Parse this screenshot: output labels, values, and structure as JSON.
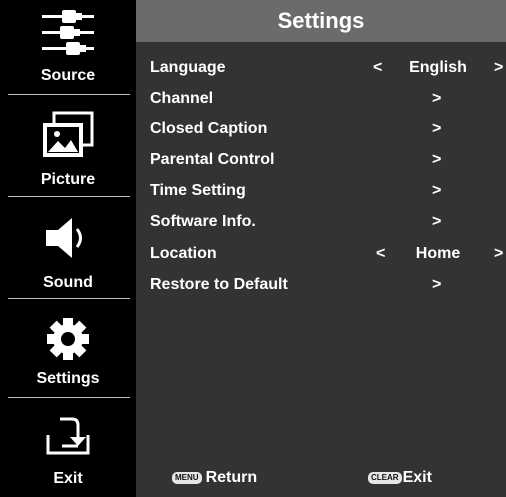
{
  "sidebar": {
    "items": [
      {
        "label": "Source",
        "icon": "source-cables-icon"
      },
      {
        "label": "Picture",
        "icon": "picture-icon"
      },
      {
        "label": "Sound",
        "icon": "speaker-icon"
      },
      {
        "label": "Settings",
        "icon": "gear-icon"
      },
      {
        "label": "Exit",
        "icon": "exit-icon"
      }
    ]
  },
  "panel": {
    "title": "Settings",
    "rows": [
      {
        "label": "Language",
        "left": "<",
        "value": "English",
        "right": ">"
      },
      {
        "label": "Channel",
        "arrow": ">"
      },
      {
        "label": "Closed Caption",
        "arrow": ">"
      },
      {
        "label": "Parental Control",
        "arrow": ">"
      },
      {
        "label": "Time Setting",
        "arrow": ">"
      },
      {
        "label": "Software Info.",
        "arrow": ">"
      },
      {
        "label": "Location",
        "left": "<",
        "value": "Home",
        "right": ">"
      },
      {
        "label": "Restore to Default",
        "arrow": ">"
      }
    ]
  },
  "footer": {
    "menu_key": "MENU",
    "return_label": "Return",
    "clear_key": "CLEAR",
    "exit_label": "Exit"
  },
  "colors": {
    "sidebar_bg": "#000000",
    "panel_bg": "#333333",
    "title_bar": "#6b6b6b",
    "text": "#ffffff"
  }
}
